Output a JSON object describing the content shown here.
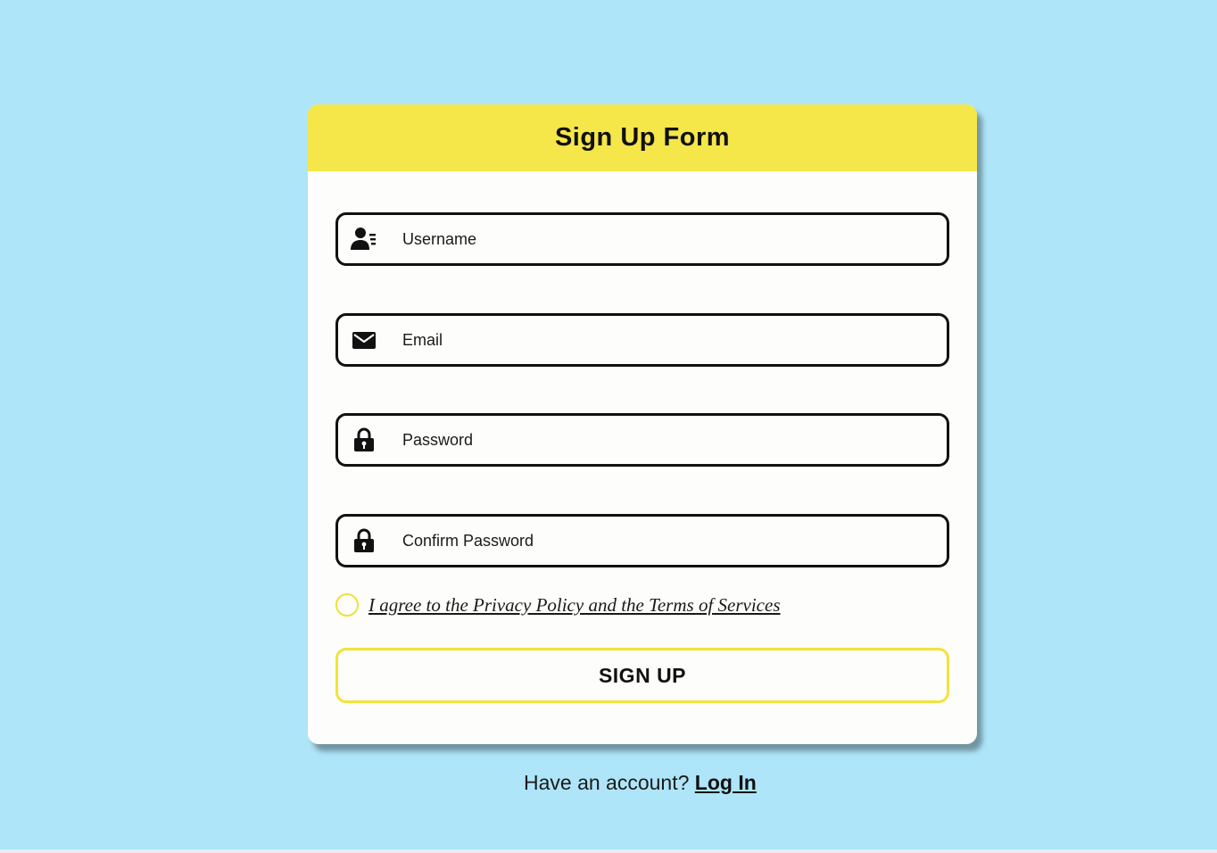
{
  "form": {
    "title": "Sign Up Form",
    "fields": [
      {
        "icon": "user-list-icon",
        "placeholder": "Username"
      },
      {
        "icon": "envelope-icon",
        "placeholder": "Email"
      },
      {
        "icon": "lock-icon",
        "placeholder": "Password"
      },
      {
        "icon": "lock-icon",
        "placeholder": "Confirm Password"
      }
    ],
    "agree_label": "I agree to the Privacy Policy and the Terms of Services",
    "submit_label": "SIGN UP"
  },
  "footer": {
    "prompt": "Have an account?",
    "login_label": "Log In"
  },
  "colors": {
    "background": "#aee5f8",
    "header": "#f5e64a",
    "accent_border": "#f3e23c",
    "card": "#fdfdfb",
    "text": "#111111"
  }
}
